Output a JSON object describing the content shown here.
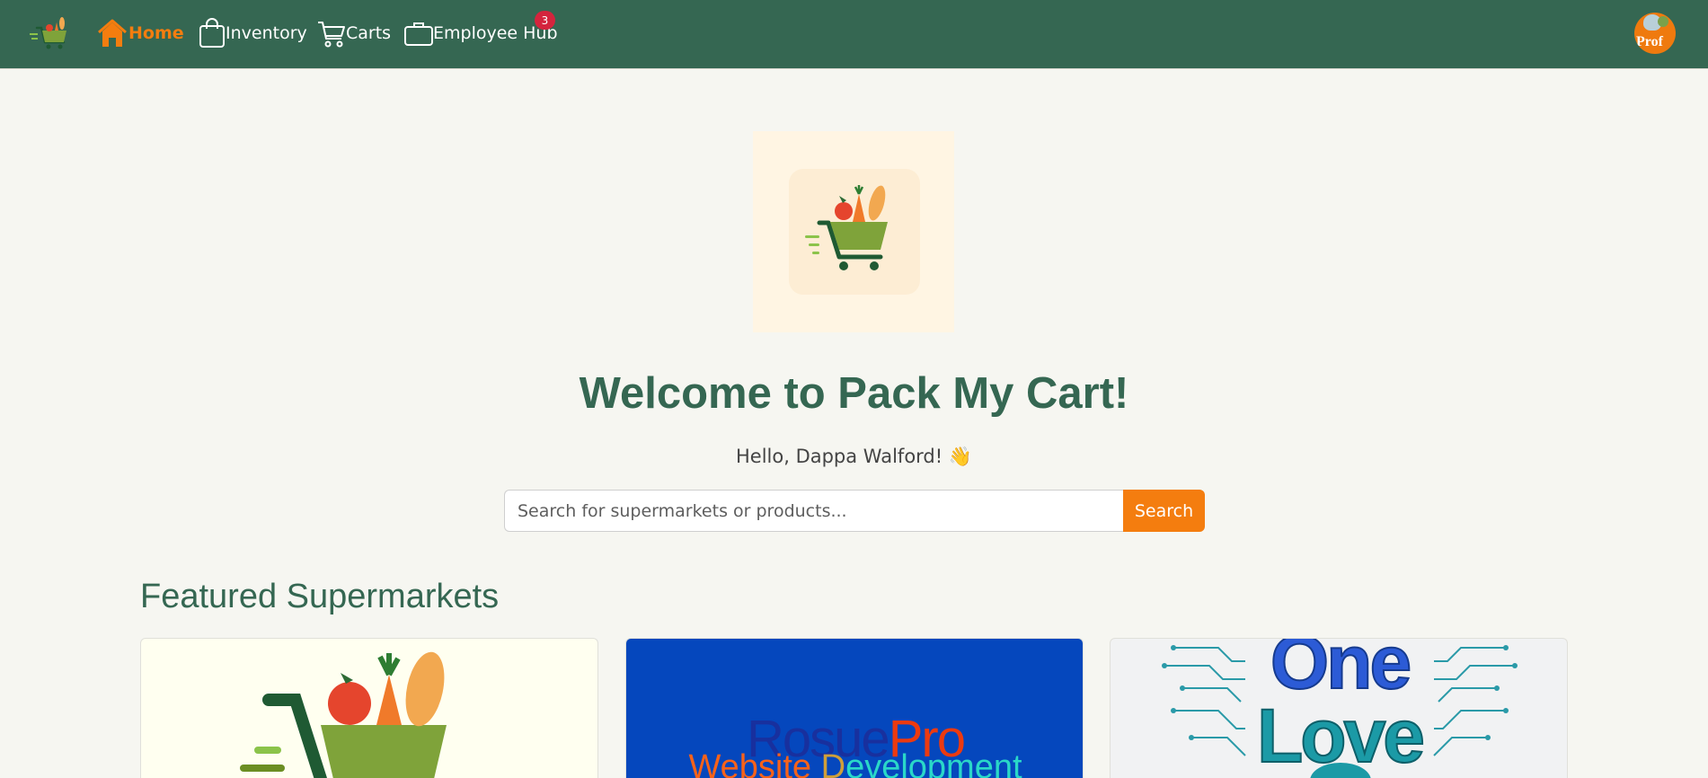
{
  "nav": {
    "logo_icon": "shopping-cart-logo-icon",
    "items": [
      {
        "label": "Home",
        "icon": "home-icon",
        "active": true
      },
      {
        "label": "Inventory",
        "icon": "shopping-bag-icon",
        "active": false
      },
      {
        "label": "Carts",
        "icon": "cart-icon",
        "active": false
      },
      {
        "label": "Employee Hub",
        "icon": "briefcase-icon",
        "active": false,
        "badge": "3"
      }
    ],
    "profile_label": "Prof",
    "colors": {
      "bar": "#356752",
      "active": "#f47d0f",
      "badge": "#d4243d"
    }
  },
  "hero": {
    "logo_icon": "shopping-cart-logo-icon",
    "title": "Welcome to Pack My Cart!",
    "greeting": "Hello, Dappa Walford! 👋"
  },
  "search": {
    "placeholder": "Search for supermarkets or products...",
    "value": "",
    "button_label": "Search"
  },
  "featured": {
    "title": "Featured Supermarkets",
    "cards": [
      {
        "image": "pack-my-cart-logo"
      },
      {
        "image": "rosuepro-banner",
        "text_1": "Rosue",
        "text_2": "Pro",
        "sub_1": "Website ",
        "sub_2": "D",
        "sub_3": "evelopment"
      },
      {
        "image": "one-love-banner",
        "line_1": "One",
        "line_2": "Love"
      }
    ]
  },
  "colors": {
    "accent": "#f47d0f",
    "brand": "#356752",
    "background": "#f6f6f1"
  }
}
